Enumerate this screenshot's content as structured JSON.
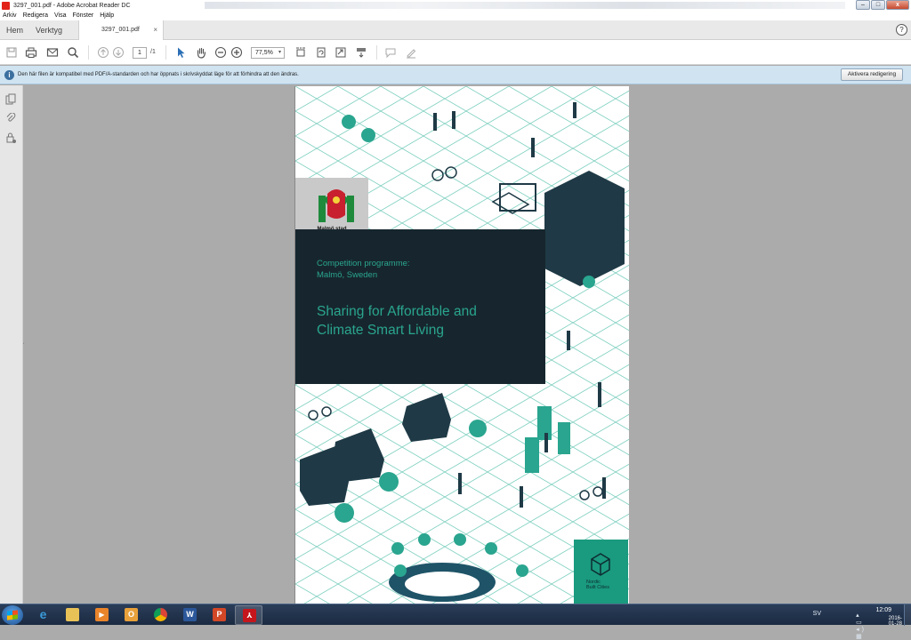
{
  "window": {
    "title": "3297_001.pdf - Adobe Acrobat Reader DC",
    "controls": {
      "minimize": "–",
      "maximize": "□",
      "close": "x"
    }
  },
  "menu": [
    "Arkiv",
    "Redigera",
    "Visa",
    "Fönster",
    "Hjälp"
  ],
  "tabs": {
    "home": "Hem",
    "tools": "Verktyg",
    "document": "3297_001.pdf",
    "close": "×",
    "help": "?"
  },
  "toolbar": {
    "page_current": "1",
    "page_total": "/1",
    "zoom": "77,5%",
    "zoom_dropdown": "▾"
  },
  "infobar": {
    "icon": "i",
    "message": "Den här filen är kompatibel med PDF/A-standarden och har öppnats i skrivskyddat läge för att förhindra att den ändras.",
    "button": "Aktivera redigering"
  },
  "document": {
    "logo_label": "Malmö stad",
    "kicker_line1": "Competition programme:",
    "kicker_line2": "Malmö, Sweden",
    "headline_line1": "Sharing for Affordable and",
    "headline_line2": "Climate Smart Living",
    "nbc_line1": "Nordic",
    "nbc_line2": "Built Cities"
  },
  "taskbar": {
    "apps": [
      "internet-explorer",
      "file-explorer",
      "media-player",
      "outlook",
      "chrome",
      "word",
      "powerpoint",
      "acrobat"
    ],
    "word_glyph": "W",
    "outlook_glyph": "O",
    "ppt_glyph": "P",
    "language": "SV",
    "time": "12:09",
    "date": "2016-01-28"
  },
  "colors": {
    "teal": "#2aa58f",
    "dark_panel": "#17262e",
    "infobar": "#cfe3f1",
    "taskbar": "#1b2a41"
  }
}
